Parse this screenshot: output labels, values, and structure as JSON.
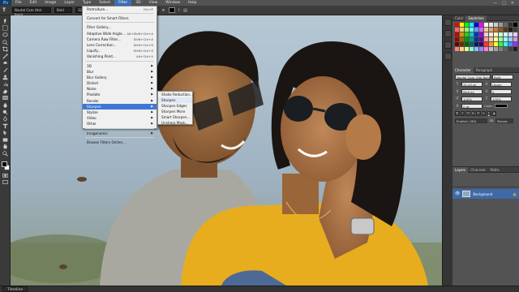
{
  "app": {
    "logo": "Ps",
    "window_controls": [
      "—",
      "□",
      "✕"
    ]
  },
  "menubar": {
    "items": [
      {
        "label": "File"
      },
      {
        "label": "Edit"
      },
      {
        "label": "Image"
      },
      {
        "label": "Layer"
      },
      {
        "label": "Type"
      },
      {
        "label": "Select"
      },
      {
        "label": "Filter",
        "active": true
      },
      {
        "label": "3D"
      },
      {
        "label": "View"
      },
      {
        "label": "Window"
      },
      {
        "label": "Help"
      }
    ]
  },
  "options": {
    "font_family": "Nautal Cam (Hal Bold)",
    "font_style": "Bold",
    "font_size": "32 pt",
    "aa": "Sharp"
  },
  "filter_menu": {
    "items": [
      {
        "label": "Portraiture...",
        "shortcut": "Ctrl+F"
      },
      {
        "sep": true
      },
      {
        "label": "Convert for Smart Filters",
        "shortcut": ""
      },
      {
        "sep": true
      },
      {
        "label": "Filter Gallery...",
        "shortcut": ""
      },
      {
        "label": "Adaptive Wide Angle...",
        "shortcut": "Alt+Shift+Ctrl+A"
      },
      {
        "label": "Camera Raw Filter...",
        "shortcut": "Shift+Ctrl+A"
      },
      {
        "label": "Lens Correction...",
        "shortcut": "Shift+Ctrl+R"
      },
      {
        "label": "Liquify...",
        "shortcut": "Shift+Ctrl+X"
      },
      {
        "label": "Vanishing Point...",
        "shortcut": "Alt+Ctrl+V"
      },
      {
        "sep": true
      },
      {
        "label": "3D",
        "sub": true
      },
      {
        "label": "Blur",
        "sub": true
      },
      {
        "label": "Blur Gallery",
        "sub": true
      },
      {
        "label": "Distort",
        "sub": true
      },
      {
        "label": "Noise",
        "sub": true
      },
      {
        "label": "Pixelate",
        "sub": true
      },
      {
        "label": "Render",
        "sub": true
      },
      {
        "label": "Sharpen",
        "sub": true,
        "highlighted": true
      },
      {
        "label": "Stylize",
        "sub": true
      },
      {
        "label": "Video",
        "sub": true
      },
      {
        "label": "Other",
        "sub": true
      },
      {
        "sep": true
      },
      {
        "label": "Imagenomic",
        "sub": true
      },
      {
        "sep": true
      },
      {
        "label": "Browse Filters Online...",
        "shortcut": ""
      }
    ]
  },
  "sharpen_submenu": {
    "items": [
      {
        "label": "Shake Reduction..."
      },
      {
        "label": "Sharpen"
      },
      {
        "label": "Sharpen Edges"
      },
      {
        "label": "Sharpen More"
      },
      {
        "label": "Smart Sharpen..."
      },
      {
        "label": "Unsharp Mask..."
      }
    ]
  },
  "right_panel": {
    "swatch_tabs": [
      "Color",
      "Swatches"
    ],
    "character_tabs": [
      "Character",
      "Paragraph"
    ],
    "character": {
      "font": "Nautal Cam (Hal Bold)",
      "style": "Bold",
      "size": "32.43 pt",
      "leading": "(Auto)",
      "kerning": "Metrics",
      "tracking": "0",
      "vscale": "100%",
      "hscale": "100%",
      "baseline": "0 pt",
      "color_label": "Color:",
      "language": "English: USA",
      "aa": "Strong"
    },
    "layer_tabs": [
      "Layers",
      "Channels",
      "Paths"
    ],
    "layer_name": "Background",
    "swatch_colors": [
      "#ff0000",
      "#ffff00",
      "#00ff00",
      "#00ffff",
      "#0000ff",
      "#ff00ff",
      "#ffffff",
      "#e6e6e6",
      "#cccccc",
      "#999999",
      "#666666",
      "#333333",
      "#000000",
      "#ff6666",
      "#ffcc66",
      "#99ff66",
      "#66ffff",
      "#6699ff",
      "#cc66ff",
      "#f2c9a0",
      "#e0a070",
      "#c87a3a",
      "#8b5a2b",
      "#5a3a1a",
      "#2a1a0a",
      "#404040",
      "#cc0000",
      "#cc9900",
      "#33cc00",
      "#00cccc",
      "#0033cc",
      "#9900cc",
      "#ffcccc",
      "#ffe6cc",
      "#ffffcc",
      "#ccffcc",
      "#ccffff",
      "#cce0ff",
      "#e6ccff",
      "#990000",
      "#996600",
      "#009900",
      "#009999",
      "#003399",
      "#660099",
      "#ff9999",
      "#ffcc99",
      "#ffff99",
      "#99ff99",
      "#99ffff",
      "#99ccff",
      "#cc99ff",
      "#660000",
      "#663300",
      "#006600",
      "#006666",
      "#001a66",
      "#330066",
      "#ff3333",
      "#ff9933",
      "#ffff33",
      "#33ff33",
      "#33ffff",
      "#3399ff",
      "#9933ff",
      "#ff8080",
      "#ffd280",
      "#e5ff80",
      "#80ffd2",
      "#80c3ff",
      "#a080ff",
      "#ff80d2",
      "#c0c0c0",
      "#a0a0a0",
      "#808080",
      "#606060",
      "#404040",
      "#202020"
    ]
  },
  "status": {
    "timeline_tab": "Timeline"
  }
}
